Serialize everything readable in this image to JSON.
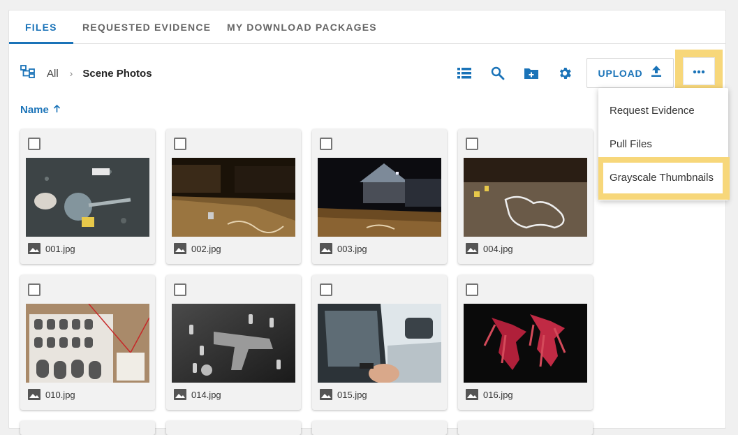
{
  "tabs": [
    {
      "label": "FILES",
      "active": true
    },
    {
      "label": "REQUESTED EVIDENCE",
      "active": false
    },
    {
      "label": "MY DOWNLOAD PACKAGES",
      "active": false
    }
  ],
  "breadcrumb": {
    "root_icon": "folder-tree-icon",
    "all_label": "All",
    "separator": "›",
    "current": "Scene Photos"
  },
  "toolbar": {
    "icons": [
      "list-view-icon",
      "search-icon",
      "new-folder-icon",
      "gear-icon"
    ],
    "upload_label": "UPLOAD",
    "upload_icon": "upload-icon",
    "more_icon": "more-horizontal-icon"
  },
  "sort": {
    "label": "Name",
    "direction_icon": "arrow-up-icon"
  },
  "files": [
    {
      "name": "001.jpg"
    },
    {
      "name": "002.jpg"
    },
    {
      "name": "003.jpg"
    },
    {
      "name": "004.jpg"
    },
    {
      "name": "010.jpg"
    },
    {
      "name": "014.jpg"
    },
    {
      "name": "015.jpg"
    },
    {
      "name": "016.jpg"
    }
  ],
  "menu": {
    "items": [
      {
        "label": "Request Evidence"
      },
      {
        "label": "Pull Files"
      },
      {
        "label": "Grayscale Thumbnails",
        "highlighted": true
      }
    ]
  },
  "colors": {
    "accent": "#1a73b8",
    "highlight": "#f7d77a"
  }
}
